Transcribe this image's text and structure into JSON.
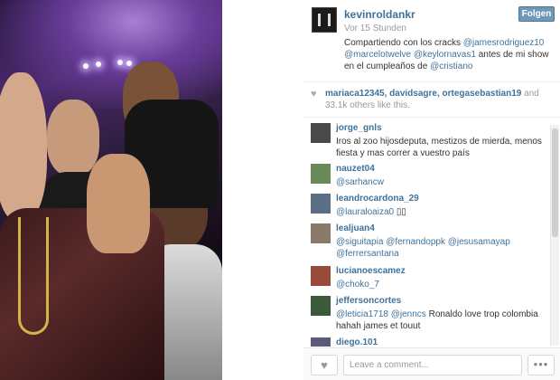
{
  "post": {
    "username": "kevinroldankr",
    "time": "Vor 15 Stunden",
    "follow_label": "Folgen",
    "caption_parts": [
      {
        "text": "Compartiendo con los cracks ",
        "mention": false
      },
      {
        "text": "@jamesrodriguez10",
        "mention": true
      },
      {
        "text": " ",
        "mention": false
      },
      {
        "text": "@marcelotwelve",
        "mention": true
      },
      {
        "text": " ",
        "mention": false
      },
      {
        "text": "@keylornavas1",
        "mention": true
      },
      {
        "text": " antes de mi show en el cumpleaños de ",
        "mention": false
      },
      {
        "text": "@cristiano",
        "mention": true
      }
    ]
  },
  "likes": {
    "names": "mariaca12345, davidsagre, ortegasebastian19",
    "rest": " and 33.1k others like this."
  },
  "comments": [
    {
      "user": "jorge_gnls",
      "avatar_color": "#4a4a4a",
      "parts": [
        {
          "text": "Iros al zoo hijosdeputa, mestizos de mierda, menos fiesta y mas correr a vuestro país",
          "mention": false
        }
      ]
    },
    {
      "user": "nauzet04",
      "avatar_color": "#6a8a5a",
      "parts": [
        {
          "text": "@sarhancw",
          "mention": true
        }
      ]
    },
    {
      "user": "leandrocardona_29",
      "avatar_color": "#5a6f86",
      "parts": [
        {
          "text": "@lauraloaiza0",
          "mention": true
        },
        {
          "text": " ▯▯",
          "mention": false
        }
      ]
    },
    {
      "user": "lealjuan4",
      "avatar_color": "#8a7a6a",
      "parts": [
        {
          "text": "@siguitapia",
          "mention": true
        },
        {
          "text": " ",
          "mention": false
        },
        {
          "text": "@fernandoppk",
          "mention": true
        },
        {
          "text": " ",
          "mention": false
        },
        {
          "text": "@jesusamayap",
          "mention": true
        },
        {
          "text": " ",
          "mention": false
        },
        {
          "text": "@ferrersantana",
          "mention": true
        }
      ]
    },
    {
      "user": "lucianoescamez",
      "avatar_color": "#9a4a3a",
      "parts": [
        {
          "text": "@choko_7",
          "mention": true
        }
      ]
    },
    {
      "user": "jeffersoncortes",
      "avatar_color": "#3a5a3a",
      "parts": [
        {
          "text": "@leticia1718",
          "mention": true
        },
        {
          "text": " ",
          "mention": false
        },
        {
          "text": "@jenncs",
          "mention": true
        },
        {
          "text": " Ronaldo love trop colombia hahah james et touut",
          "mention": false
        }
      ]
    },
    {
      "user": "diego.101",
      "avatar_color": "#5a5a7a",
      "parts": []
    }
  ],
  "footer": {
    "comment_placeholder": "Leave a comment...",
    "like_icon": "heart-icon",
    "more_icon": "ellipsis-icon"
  },
  "colors": {
    "link": "#3f729b",
    "follow_button": "#6f97b6"
  }
}
